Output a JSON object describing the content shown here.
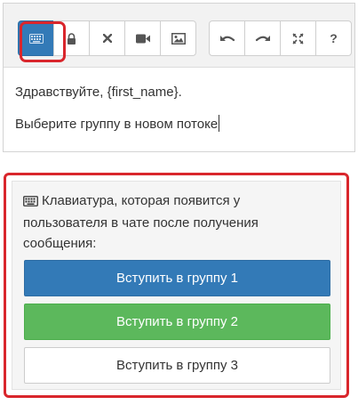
{
  "toolbar": {
    "buttons": [
      {
        "name": "keyboard-icon",
        "active": true
      },
      {
        "name": "lock-icon"
      },
      {
        "name": "close-icon"
      },
      {
        "name": "video-icon"
      },
      {
        "name": "image-icon"
      },
      {
        "name": "undo-icon"
      },
      {
        "name": "redo-icon"
      },
      {
        "name": "fullscreen-icon"
      },
      {
        "name": "help-icon",
        "glyph": "?"
      }
    ],
    "active_color": "#337ab7",
    "highlight_color": "#d9262c"
  },
  "editor": {
    "line1": "Здравствуйте, {first_name}.",
    "line2": "Выберите группу в новом потоке"
  },
  "keyboard_preview": {
    "description": "Клавиатура, которая появится у пользователя в чате после получения сообщения:",
    "buttons": [
      {
        "label": "Вступить в группу 1",
        "color": "#337ab7"
      },
      {
        "label": "Вступить в группу 2",
        "color": "#5cb85c"
      },
      {
        "label": "Вступить в группу 3",
        "color": "#ffffff"
      }
    ]
  }
}
